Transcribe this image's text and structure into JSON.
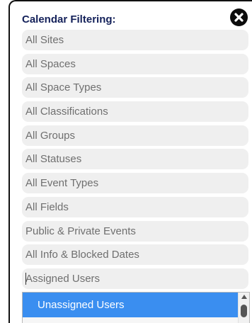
{
  "panel": {
    "title": "Calendar Filtering:",
    "close_icon": "close-circle-icon"
  },
  "filters": [
    {
      "label": "All Sites"
    },
    {
      "label": "All Spaces"
    },
    {
      "label": "All Space Types"
    },
    {
      "label": "All Classifications"
    },
    {
      "label": "All Groups"
    },
    {
      "label": "All Statuses"
    },
    {
      "label": "All Event Types"
    },
    {
      "label": "All Fields"
    },
    {
      "label": "Public & Private Events"
    },
    {
      "label": "All Info & Blocked Dates"
    },
    {
      "label": "Assigned Users"
    }
  ],
  "dropdown": {
    "options": [
      {
        "label": "Unassigned Users",
        "selected": true
      }
    ]
  },
  "colors": {
    "title": "#14215a",
    "filter_bg": "#efefef",
    "filter_text": "#6f6f6f",
    "selected_option": "#3a8ef0"
  }
}
